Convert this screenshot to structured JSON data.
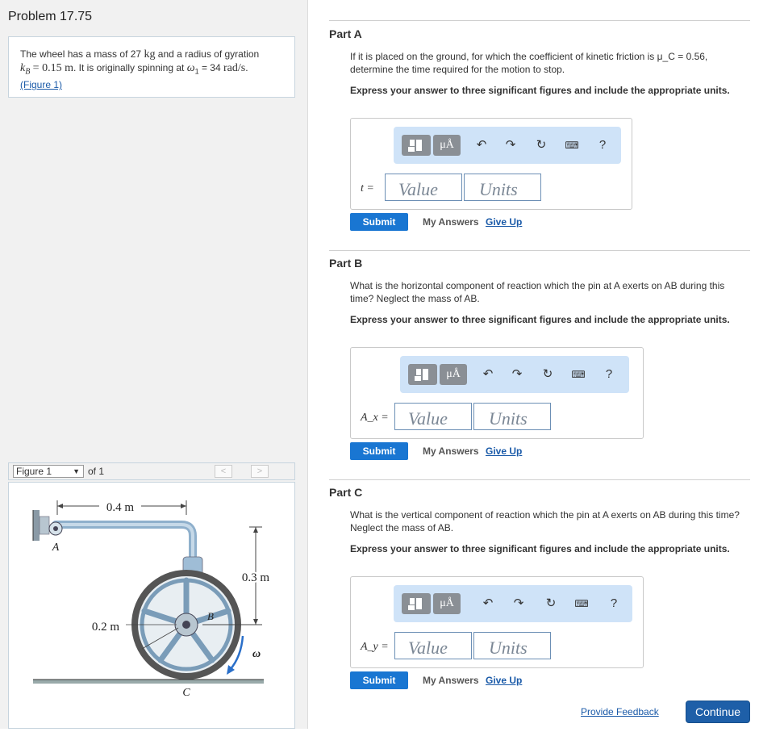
{
  "problem": {
    "title": "Problem 17.75",
    "text_1": "The wheel has a mass of 27",
    "unit_kg": "kg",
    "text_2": "and a radius of gyration",
    "kb_sym": "k",
    "kb_sub": "B",
    "kb_val": "= 0.15 m",
    "text_3": ". It is originally spinning at",
    "omega_sym": "ω",
    "omega_sub": "1",
    "text_4": "= 34",
    "unit_rads": "rad/s",
    "text_5": ".",
    "figure_link": "(Figure 1)"
  },
  "figure_nav": {
    "select_value": "Figure 1",
    "of_label": "of 1",
    "prev_label": "<",
    "next_label": ">"
  },
  "figure": {
    "label_04m": "0.4 m",
    "label_03m": "0.3 m",
    "label_02m": "0.2 m",
    "label_A": "A",
    "label_B": "B",
    "label_C": "C",
    "label_omega": "ω"
  },
  "parts": [
    {
      "title": "Part A",
      "question": "If it is placed on the ground, for which the coefficient of kinetic friction is μ_C = 0.56, determine the time required for the motion to stop.",
      "instruction": "Express your answer to three significant figures and include the appropriate units.",
      "var_label": "t =",
      "value_placeholder": "Value",
      "units_placeholder": "Units"
    },
    {
      "title": "Part B",
      "question": "What is the horizontal component of reaction which the pin at A exerts on AB during this time? Neglect the mass of AB.",
      "instruction": "Express your answer to three significant figures and include the appropriate units.",
      "var_label": "A_x =",
      "value_placeholder": "Value",
      "units_placeholder": "Units"
    },
    {
      "title": "Part C",
      "question": "What is the vertical component of reaction which the pin at A exerts on AB during this time? Neglect the mass of AB.",
      "instruction": "Express your answer to three significant figures and include the appropriate units.",
      "var_label": "A_y =",
      "value_placeholder": "Value",
      "units_placeholder": "Units"
    }
  ],
  "toolbar": {
    "mu_label": "μÅ",
    "help_label": "?"
  },
  "actions": {
    "submit_label": "Submit",
    "my_answers_label": "My Answers",
    "give_up_label": "Give Up"
  },
  "footer": {
    "feedback_label": "Provide Feedback",
    "continue_label": "Continue"
  },
  "colors": {
    "submit_blue": "#1976d2",
    "toolbar_bg": "#cfe3f8",
    "continue_blue": "#1e5fa8"
  }
}
